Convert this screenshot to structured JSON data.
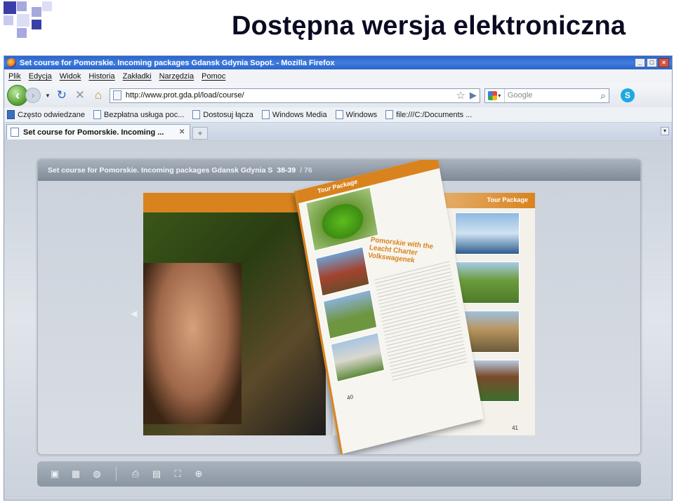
{
  "slide": {
    "title": "Dostępna wersja elektroniczna",
    "accent_color": "#3a3fa8"
  },
  "browser": {
    "window_title": "Set course for Pomorskie. Incoming packages Gdansk Gdynia Sopot. - Mozilla Firefox",
    "window_buttons": [
      "_",
      "□",
      "×"
    ],
    "menu": [
      "Plik",
      "Edycja",
      "Widok",
      "Historia",
      "Zakładki",
      "Narzędzia",
      "Pomoc"
    ],
    "url": "http://www.prot.gda.pl/load/course/",
    "search_placeholder": "Google",
    "bookmarks": [
      "Często odwiedzane",
      "Bezpłatna usługa poc...",
      "Dostosuj łącza",
      "Windows Media",
      "Windows",
      "file:///C:/Documents ..."
    ],
    "tab_title": "Set course for Pomorskie. Incoming ...",
    "new_tab_label": "+"
  },
  "flipbook": {
    "header_title": "Set course for Pomorskie. Incoming packages Gdansk Gdynia S",
    "pages": "38-39",
    "total": "/ 76",
    "curl_label": "Tour Package",
    "curl_heading": "Pomorskie with the Leacht Charter Volkswagenek",
    "right_label": "Tour Package",
    "left_page_number": "40",
    "right_page_number": "41"
  },
  "icons": [
    "back-arrow-icon",
    "forward-arrow-icon",
    "reload-icon",
    "stop-icon",
    "home-icon",
    "page-icon",
    "star-icon",
    "go-arrow-icon",
    "google-icon",
    "search-icon",
    "skype-icon",
    "bookmark-page-icon",
    "close-tab-icon",
    "single-page-icon",
    "thumbnails-icon",
    "globe-icon",
    "print-icon",
    "save-icon",
    "fullscreen-icon",
    "zoom-in-icon"
  ]
}
